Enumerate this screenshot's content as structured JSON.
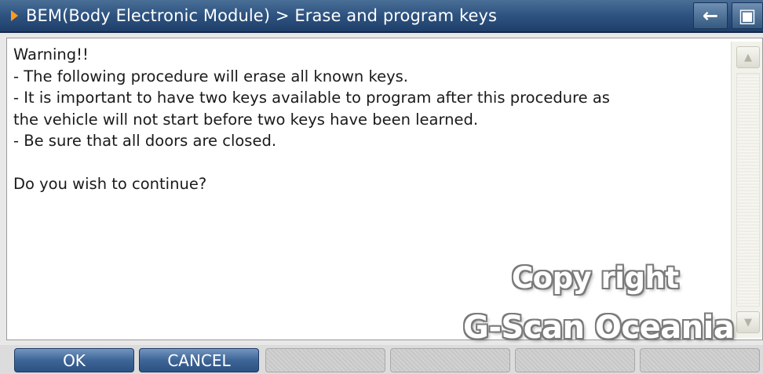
{
  "titlebar": {
    "title": "BEM(Body Electronic Module) > Erase and program keys",
    "buttons": [
      {
        "name": "back",
        "icon": "left-arrow-icon",
        "glyph": "←"
      },
      {
        "name": "camera",
        "icon": "camera-icon",
        "glyph": "▣"
      }
    ]
  },
  "message": {
    "lines": [
      "Warning!!",
      "- The following procedure will erase all known keys.",
      "- It is important to have two keys available to program after this procedure as",
      "the vehicle will not start before two keys have been learned.",
      "- Be sure that all doors are closed.",
      "",
      "Do you wish to continue?"
    ]
  },
  "watermark": {
    "line1": "Copy right",
    "line2": "G-Scan Oceania"
  },
  "bottom_buttons": {
    "ok": "OK",
    "cancel": "CANCEL"
  },
  "colors": {
    "titlebar": "#2f5582",
    "title_arrow": "#ff9a1f",
    "active_button": "#3e6597"
  }
}
